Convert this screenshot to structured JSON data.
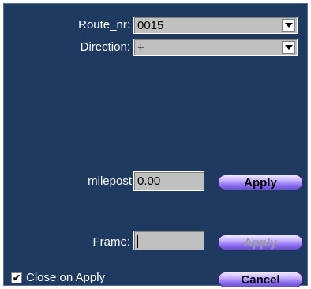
{
  "route": {
    "label": "Route_nr:",
    "value": "0015"
  },
  "direction": {
    "label": "Direction:",
    "value": "+"
  },
  "milepost": {
    "label": "milepost",
    "value": "0.00",
    "apply_label": "Apply"
  },
  "frame": {
    "label": "Frame:",
    "value": "",
    "apply_label": "Apply"
  },
  "close_on_apply": {
    "label": "Close on Apply",
    "checked": true,
    "check_glyph": "✔"
  },
  "cancel_label": "Cancel"
}
